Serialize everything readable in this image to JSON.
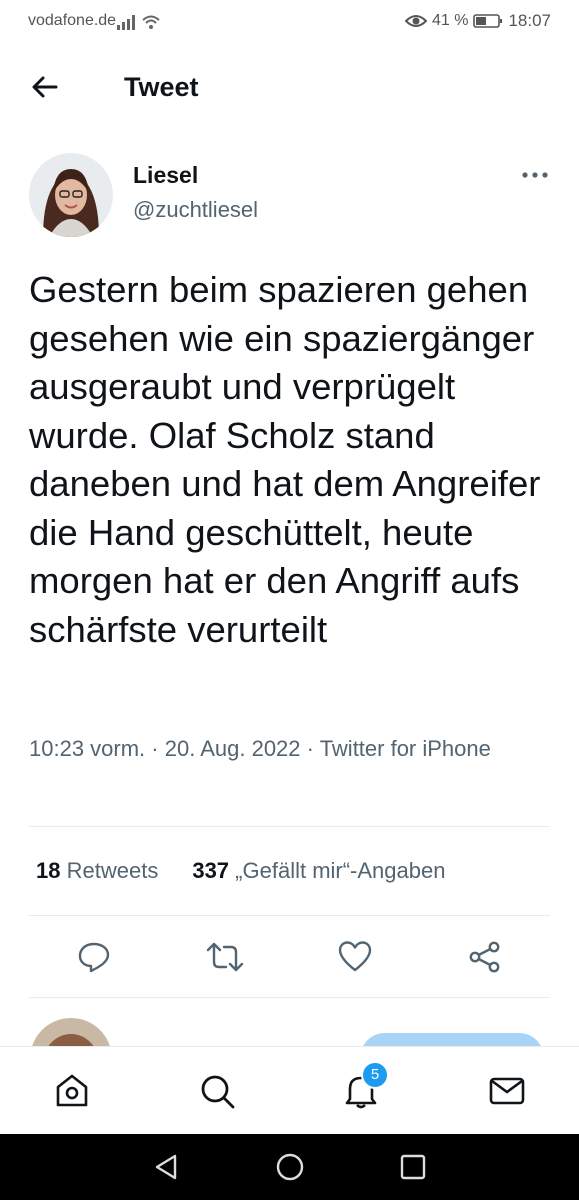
{
  "status_bar": {
    "carrier": "vodafone.de",
    "battery": "41 %",
    "time": "18:07"
  },
  "header": {
    "title": "Tweet"
  },
  "author": {
    "name": "Liesel",
    "handle": "@zuchtliesel"
  },
  "tweet": {
    "text": "Gestern beim spazieren gehen gesehen wie ein spaziergänger ausgeraubt und verprügelt wurde. Olaf Scholz stand daneben und hat dem Angreifer die Hand geschüttelt, heute morgen hat er den Angriff aufs schärfste verurteilt",
    "time": "10:23 vorm.",
    "date": "20. Aug. 2022",
    "source": "Twitter for iPhone"
  },
  "stats": {
    "retweets_count": "18",
    "retweets_label": "Retweets",
    "likes_count": "337",
    "likes_label": "„Gefällt mir“-Angaben"
  },
  "notifications_badge": "5",
  "colors": {
    "accent": "#1d9bf0",
    "text_primary": "#0f1419",
    "text_secondary": "#536471",
    "action_icons": "#536471"
  },
  "icons": {
    "back": "arrow-left-icon",
    "more": "ellipsis-icon",
    "reply": "reply-icon",
    "retweet": "retweet-icon",
    "like": "heart-icon",
    "share": "share-icon",
    "home": "home-icon",
    "search": "search-icon",
    "notifications": "bell-icon",
    "messages": "mail-icon"
  }
}
